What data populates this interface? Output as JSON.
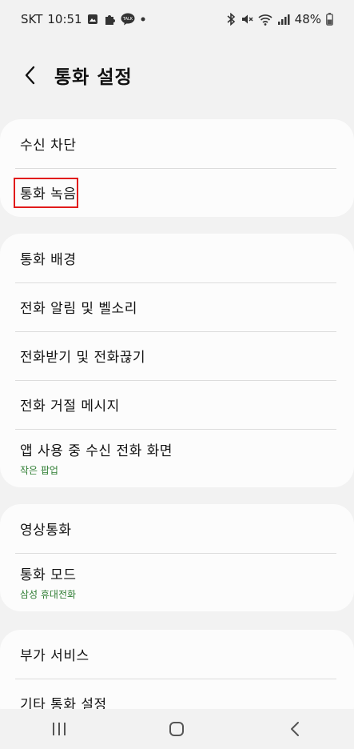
{
  "status_bar": {
    "carrier": "SKT",
    "time": "10:51",
    "battery": "48%",
    "icons_left": [
      "gallery-icon",
      "puzzle-icon",
      "talk-icon",
      "dot-icon"
    ],
    "icons_right": [
      "bluetooth-icon",
      "mute-icon",
      "wifi-icon",
      "signal-icon",
      "battery-icon"
    ],
    "talk_badge": "TALK"
  },
  "header": {
    "title": "통화 설정",
    "back_icon": "back-arrow-icon"
  },
  "groups": [
    {
      "items": [
        {
          "label": "수신 차단"
        },
        {
          "label": "통화 녹음",
          "highlighted": true
        }
      ]
    },
    {
      "items": [
        {
          "label": "통화 배경"
        },
        {
          "label": "전화 알림 및 벨소리"
        },
        {
          "label": "전화받기 및 전화끊기"
        },
        {
          "label": "전화 거절 메시지"
        },
        {
          "label": "앱 사용 중 수신 전화 화면",
          "sub": "작은 팝업"
        }
      ]
    },
    {
      "items": [
        {
          "label": "영상통화"
        },
        {
          "label": "통화 모드",
          "sub": "삼성 휴대전화"
        }
      ]
    },
    {
      "items": [
        {
          "label": "부가 서비스"
        },
        {
          "label": "기타 통화 설정"
        }
      ]
    }
  ],
  "nav_bar": {
    "buttons": [
      "recents-icon",
      "home-icon",
      "back-icon"
    ]
  },
  "colors": {
    "background": "#f2f2f2",
    "card": "#fcfcfc",
    "subtext": "#2e7d32",
    "highlight": "#e11b1b"
  }
}
